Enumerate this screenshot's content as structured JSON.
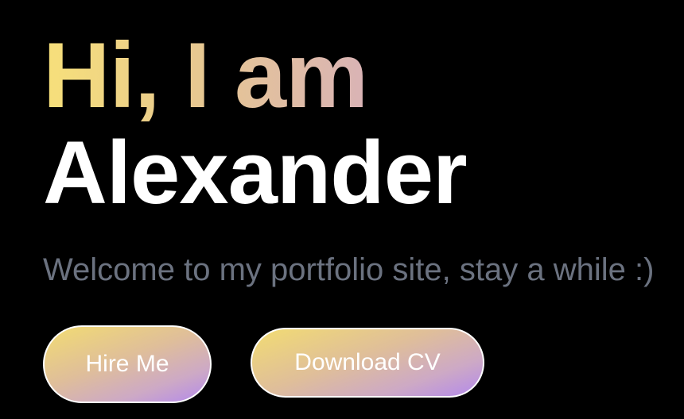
{
  "hero": {
    "greeting": "Hi, I am",
    "name": "Alexander",
    "tagline": "Welcome to my portfolio site, stay a while :)"
  },
  "buttons": {
    "hire_label": "Hire Me",
    "cv_label": "Download CV"
  },
  "colors": {
    "background": "#000000",
    "greeting_gradient_start": "#f7e07a",
    "greeting_gradient_end": "#d9b3b6",
    "name": "#ffffff",
    "tagline": "#6b7280",
    "button_gradient_start": "#f2dc72",
    "button_gradient_end": "#b389ec",
    "button_border": "#ffffff"
  }
}
